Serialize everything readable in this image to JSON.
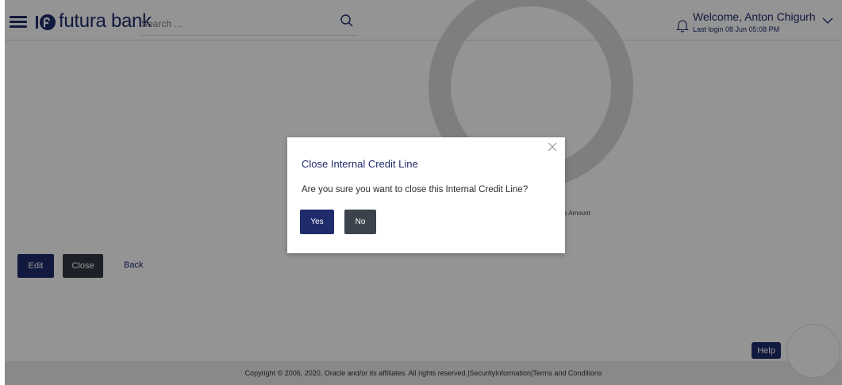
{
  "header": {
    "brand": "futura bank",
    "search_placeholder": "Search ...",
    "welcome": "Welcome, Anton Chigurh",
    "last_login": "Last login 08 Jun 05:08 PM"
  },
  "icons": {
    "menu": "hamburger-menu-icon",
    "logo": "futura-bank-logo",
    "search": "search-icon",
    "notifications": "bell-icon",
    "user_menu": "chevron-down-icon",
    "modal_close": "close-icon"
  },
  "main": {
    "partial_label": "e Amount",
    "actions": {
      "edit": "Edit",
      "close": "Close",
      "back": "Back"
    }
  },
  "modal": {
    "title": "Close Internal Credit Line",
    "message": "Are you sure you want to close this Internal Credit Line?",
    "yes": "Yes",
    "no": "No"
  },
  "help": {
    "label": "Help"
  },
  "footer": {
    "text": "Copyright © 2006, 2020, Oracle and/or its affiliates. All rights reserved.|SecurityInformation|Terms and Conditions"
  },
  "colors": {
    "brand": "#1f2b6b",
    "secondary_button": "#333a44",
    "overlay": "rgba(0,0,0,0.42)"
  }
}
